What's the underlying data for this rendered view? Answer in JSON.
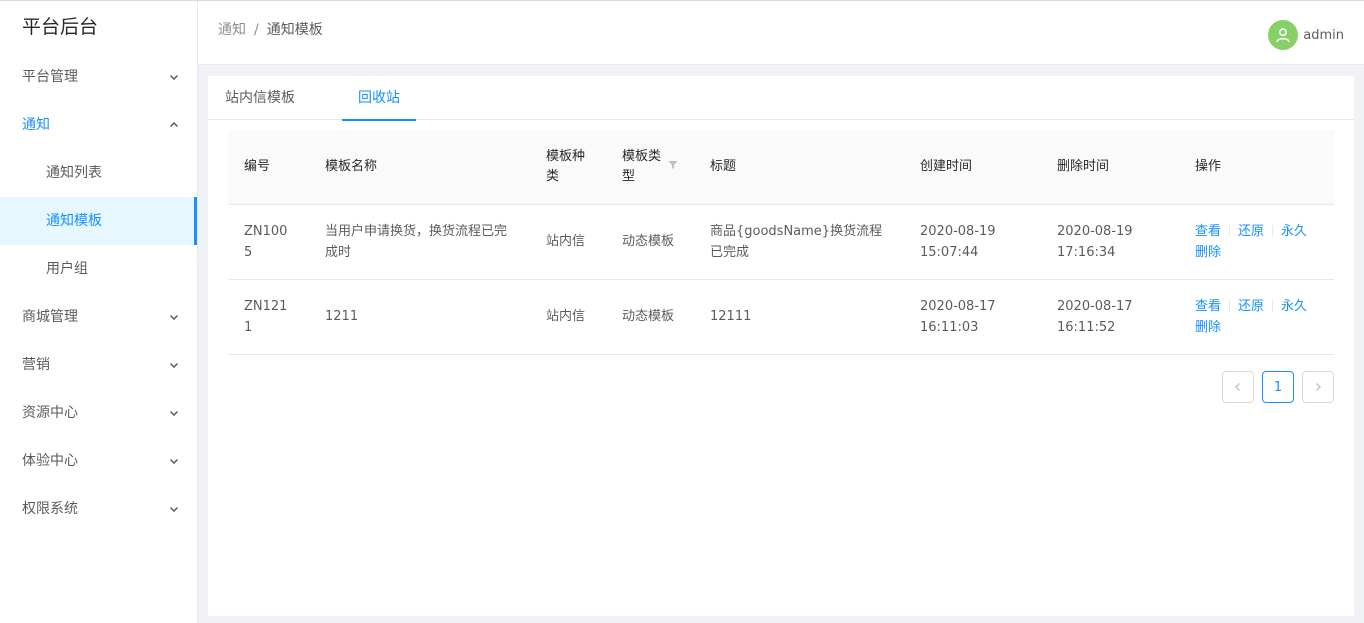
{
  "app": {
    "title": "平台后台"
  },
  "sidebar": {
    "items": [
      {
        "label": "平台管理"
      },
      {
        "label": "通知"
      },
      {
        "label": "通知列表"
      },
      {
        "label": "通知模板"
      },
      {
        "label": "用户组"
      },
      {
        "label": "商城管理"
      },
      {
        "label": "营销"
      },
      {
        "label": "资源中心"
      },
      {
        "label": "体验中心"
      },
      {
        "label": "权限系统"
      }
    ]
  },
  "header": {
    "breadcrumb": [
      "通知",
      "/",
      "通知模板"
    ],
    "username": "admin"
  },
  "tabs": [
    {
      "label": "站内信模板"
    },
    {
      "label": "回收站"
    }
  ],
  "table": {
    "columns": [
      "编号",
      "模板名称",
      "模板种类",
      "模板类型",
      "标题",
      "创建时间",
      "删除时间",
      "操作"
    ],
    "rows": [
      {
        "id": "ZN1005",
        "name": "当用户申请换货，换货流程已完成时",
        "kind": "站内信",
        "type": "动态模板",
        "title": "商品{goodsName}换货流程已完成",
        "created_date": "2020-08-19",
        "created_time": "15:07:44",
        "deleted_date": "2020-08-19",
        "deleted_time": "17:16:34"
      },
      {
        "id": "ZN1211",
        "name": "1211",
        "kind": "站内信",
        "type": "动态模板",
        "title": "12111",
        "created_date": "2020-08-17",
        "created_time": "16:11:03",
        "deleted_date": "2020-08-17",
        "deleted_time": "16:11:52"
      }
    ],
    "actions": {
      "view": "查看",
      "restore": "还原",
      "perm": "永久",
      "delete": "删除"
    }
  },
  "pagination": {
    "current": "1"
  },
  "colors": {
    "primary": "#1890ff",
    "avatar": "#87d068"
  }
}
